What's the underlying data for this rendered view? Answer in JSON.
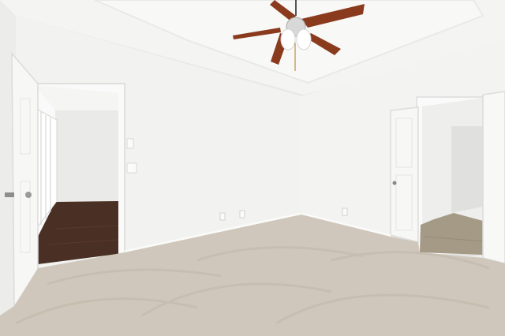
{
  "scene": {
    "description_hidden": "",
    "colors": {
      "wall": "#f2f2f0",
      "wall_shadow": "#e6e6e3",
      "ceiling": "#f4f4f2",
      "carpet": "#cfc7bb",
      "wood_floor": "#4a2f24",
      "tile_floor": "#a59a86",
      "door": "#f7f7f5",
      "fan_blade": "#8a3b1d",
      "baseboard": "#fbfbfa"
    },
    "icons": {
      "ceiling_fan": "ceiling-fan-icon",
      "door_left": "door-icon",
      "door_right": "door-icon",
      "window": "window-icon",
      "outlet": "outlet-icon",
      "switch": "light-switch-icon"
    }
  }
}
